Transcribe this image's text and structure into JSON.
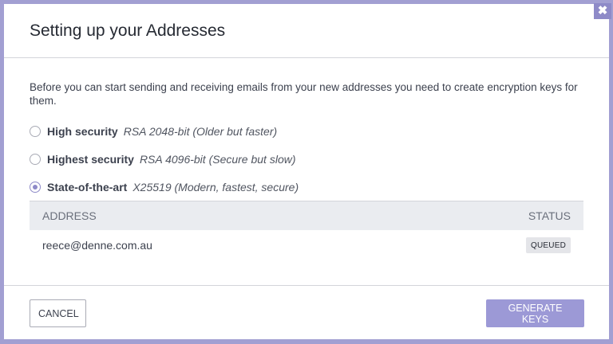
{
  "modal": {
    "title": "Setting up your Addresses",
    "close_glyph": "✖",
    "intro": "Before you can start sending and receiving emails from your new addresses you need to create encryption keys for them."
  },
  "key_options": [
    {
      "name": "High security",
      "description": "RSA 2048-bit (Older but faster)",
      "selected": false
    },
    {
      "name": "Highest security",
      "description": "RSA 4096-bit (Secure but slow)",
      "selected": false
    },
    {
      "name": "State-of-the-art",
      "description": "X25519 (Modern, fastest, secure)",
      "selected": true
    }
  ],
  "table": {
    "headers": {
      "address": "Address",
      "status": "Status"
    },
    "rows": [
      {
        "address": "reece@denne.com.au",
        "status": "QUEUED"
      }
    ]
  },
  "footer": {
    "cancel_label": "Cancel",
    "generate_label": "Generate keys"
  },
  "colors": {
    "accent": "#8e8ac8",
    "primary_button": "#9c99d6",
    "backdrop": "#a29fd2"
  }
}
